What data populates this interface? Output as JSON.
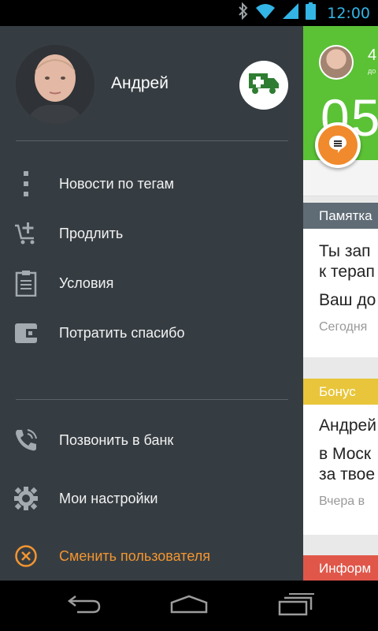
{
  "status_bar": {
    "time": "12:00",
    "icons": [
      "bluetooth-icon",
      "wifi-icon",
      "signal-icon",
      "battery-icon"
    ],
    "color": "#33b5e5"
  },
  "drawer": {
    "user_name": "Андрей",
    "menu_primary": [
      {
        "label": "Новости по тегам",
        "icon": "more-vertical-icon"
      },
      {
        "label": "Продлить",
        "icon": "cart-add-icon"
      },
      {
        "label": "Условия",
        "icon": "clipboard-icon"
      },
      {
        "label": "Потратить спасибо",
        "icon": "wallet-icon"
      }
    ],
    "menu_secondary": [
      {
        "label": "Позвонить в банк",
        "icon": "phone-call-icon"
      },
      {
        "label": "Мои настройки",
        "icon": "gear-icon"
      },
      {
        "label": "Сменить пользователя",
        "icon": "close-circle-icon"
      }
    ],
    "accent_color": "#f39530",
    "background_color": "#363d42"
  },
  "content": {
    "hero": {
      "number_small": "4",
      "sub": "до",
      "number_big": "05",
      "color": "#5bc236"
    },
    "cards": [
      {
        "tag": "Памятка",
        "tag_color": "#5f6b75",
        "lines": [
          "Ты зап",
          "к терап",
          "Ваш до"
        ],
        "meta": "Сегодня"
      },
      {
        "tag": "Бонус",
        "tag_color": "#e8c53a",
        "lines": [
          "Андрей",
          "в Моск",
          "за твое"
        ],
        "meta": "Вчера в"
      },
      {
        "tag": "Информ",
        "tag_color": "#e0574a",
        "lines": [],
        "meta": ""
      }
    ]
  },
  "nav_bar": {
    "buttons": [
      "back-icon",
      "home-icon",
      "recent-apps-icon"
    ]
  }
}
